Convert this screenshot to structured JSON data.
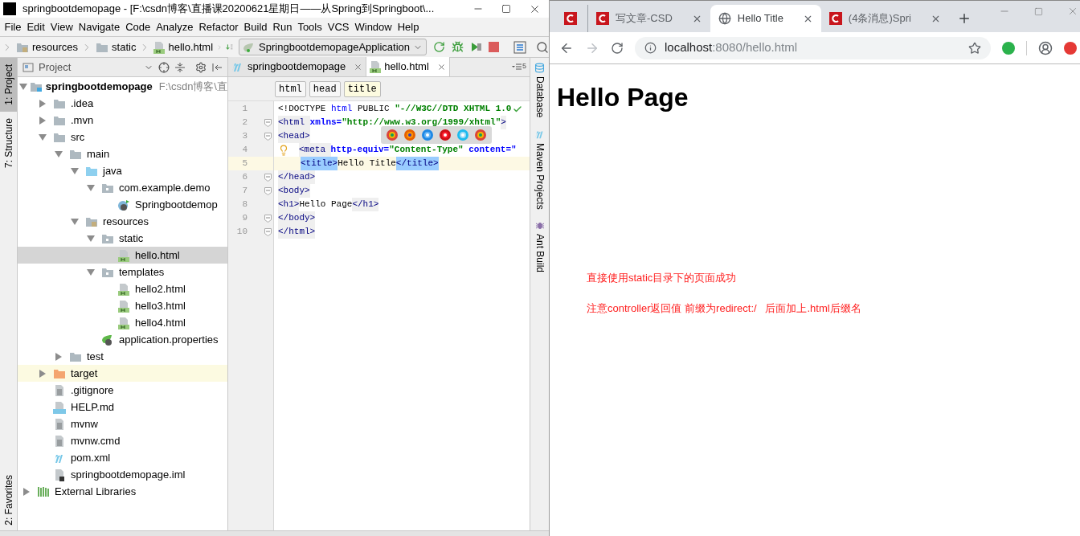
{
  "ide": {
    "title": "springbootdemopage - [F:\\csdn博客\\直播课20200621星期日——从Spring到Springboot\\...",
    "menu": [
      {
        "label": "File"
      },
      {
        "label": "Edit"
      },
      {
        "label": "View"
      },
      {
        "label": "Navigate"
      },
      {
        "label": "Code"
      },
      {
        "label": "Analyze"
      },
      {
        "label": "Refactor"
      },
      {
        "label": "Build"
      },
      {
        "label": "Run"
      },
      {
        "label": "Tools"
      },
      {
        "label": "VCS"
      },
      {
        "label": "Window"
      },
      {
        "label": "Help"
      }
    ],
    "breadcrumbs": [
      {
        "label": "resources",
        "kind": "resources"
      },
      {
        "label": "static",
        "kind": "folder"
      },
      {
        "label": "hello.html",
        "kind": "html"
      }
    ],
    "run_config": "SpringbootdemopageApplication",
    "left_stripe": [
      {
        "label": "1: Project",
        "selected": true
      },
      {
        "label": "7: Structure",
        "selected": false
      }
    ],
    "favorites_label": "2: Favorites",
    "right_stripe": [
      {
        "label": "Database",
        "kind": "database"
      },
      {
        "label": "Maven Projects",
        "kind": "maven"
      },
      {
        "label": "Ant Build",
        "kind": "ant"
      }
    ],
    "project_panel": {
      "title": "Project",
      "tree": [
        {
          "name": "springbootdemopage",
          "path": "F:\\csdn博客\\直",
          "kind": "project",
          "expanded": true,
          "selected": false,
          "highlighted": false,
          "children": [
            {
              "name": ".idea",
              "kind": "folder",
              "expanded": false,
              "selected": false,
              "highlighted": false
            },
            {
              "name": ".mvn",
              "kind": "folder",
              "expanded": false,
              "selected": false,
              "highlighted": false
            },
            {
              "name": "src",
              "kind": "folder",
              "expanded": true,
              "selected": false,
              "highlighted": false,
              "children": [
                {
                  "name": "main",
                  "kind": "folder",
                  "expanded": true,
                  "selected": false,
                  "highlighted": false,
                  "children": [
                    {
                      "name": "java",
                      "kind": "source",
                      "expanded": true,
                      "selected": false,
                      "highlighted": false,
                      "children": [
                        {
                          "name": "com.example.demo",
                          "kind": "package",
                          "expanded": true,
                          "selected": false,
                          "highlighted": false,
                          "children": [
                            {
                              "name": "Springbootdemop",
                              "kind": "class",
                              "selected": false,
                              "highlighted": false
                            }
                          ]
                        }
                      ]
                    },
                    {
                      "name": "resources",
                      "kind": "resources",
                      "expanded": true,
                      "selected": false,
                      "highlighted": false,
                      "children": [
                        {
                          "name": "static",
                          "kind": "package",
                          "expanded": true,
                          "selected": false,
                          "highlighted": false,
                          "children": [
                            {
                              "name": "hello.html",
                              "kind": "html",
                              "selected": true,
                              "highlighted": false
                            }
                          ]
                        },
                        {
                          "name": "templates",
                          "kind": "package",
                          "expanded": true,
                          "selected": false,
                          "highlighted": false,
                          "children": [
                            {
                              "name": "hello2.html",
                              "kind": "html",
                              "selected": false,
                              "highlighted": false
                            },
                            {
                              "name": "hello3.html",
                              "kind": "html",
                              "selected": false,
                              "highlighted": false
                            },
                            {
                              "name": "hello4.html",
                              "kind": "html",
                              "selected": false,
                              "highlighted": false
                            }
                          ]
                        },
                        {
                          "name": "application.properties",
                          "kind": "properties",
                          "selected": false,
                          "highlighted": false
                        }
                      ]
                    }
                  ]
                },
                {
                  "name": "test",
                  "kind": "folder",
                  "expanded": false,
                  "selected": false,
                  "highlighted": false
                }
              ]
            },
            {
              "name": "target",
              "kind": "excluded",
              "expanded": false,
              "selected": false,
              "highlighted": true
            },
            {
              "name": ".gitignore",
              "kind": "text",
              "selected": false,
              "highlighted": false
            },
            {
              "name": "HELP.md",
              "kind": "markdown",
              "selected": false,
              "highlighted": false
            },
            {
              "name": "mvnw",
              "kind": "text",
              "selected": false,
              "highlighted": false
            },
            {
              "name": "mvnw.cmd",
              "kind": "text",
              "selected": false,
              "highlighted": false
            },
            {
              "name": "pom.xml",
              "kind": "maven",
              "selected": false,
              "highlighted": false
            },
            {
              "name": "springbootdemopage.iml",
              "kind": "iml",
              "selected": false,
              "highlighted": false
            }
          ]
        },
        {
          "name": "External Libraries",
          "kind": "libraries",
          "expanded": false,
          "selected": false,
          "highlighted": false
        }
      ]
    },
    "editor": {
      "tabs": [
        {
          "label": "springbootdemopage",
          "kind": "maven",
          "selected": false
        },
        {
          "label": "hello.html",
          "kind": "html",
          "selected": true
        }
      ],
      "tab_count": "5",
      "tag_path": [
        {
          "label": "html",
          "selected": false
        },
        {
          "label": "head",
          "selected": false
        },
        {
          "label": "title",
          "selected": true
        }
      ],
      "lines": [
        {
          "number": "1",
          "current": false,
          "fold": false,
          "tokens": [
            {
              "text": "<!DOCTYPE ",
              "kind": "plain"
            },
            {
              "text": "html",
              "kind": "keyword"
            },
            {
              "text": " PUBLIC ",
              "kind": "plain"
            },
            {
              "text": "\"-//W3C//DTD XHTML 1.0",
              "kind": "string"
            }
          ]
        },
        {
          "number": "2",
          "current": false,
          "fold": true,
          "tokens": [
            {
              "text": "<html ",
              "kind": "tag"
            },
            {
              "text": "xmlns=",
              "kind": "attr"
            },
            {
              "text": "\"http://www.w3.org/1999/xhtml\"",
              "kind": "string"
            },
            {
              "text": ">",
              "kind": "tag"
            }
          ]
        },
        {
          "number": "3",
          "current": false,
          "fold": true,
          "tokens": [
            {
              "text": "<head>",
              "kind": "tag"
            }
          ]
        },
        {
          "number": "4",
          "current": false,
          "fold": false,
          "tokens": [
            {
              "text": "<meta ",
              "kind": "tag"
            },
            {
              "text": "http-equiv=",
              "kind": "attr"
            },
            {
              "text": "\"Content-Type\" ",
              "kind": "string"
            },
            {
              "text": "content=\"",
              "kind": "attr"
            }
          ]
        },
        {
          "number": "5",
          "current": true,
          "fold": false,
          "tokens": [
            {
              "text": "<title>",
              "kind": "matched"
            },
            {
              "text": "Hello Title",
              "kind": "text"
            },
            {
              "text": "</title>",
              "kind": "matched"
            }
          ]
        },
        {
          "number": "6",
          "current": false,
          "fold": true,
          "tokens": [
            {
              "text": "</head>",
              "kind": "tag"
            }
          ]
        },
        {
          "number": "7",
          "current": false,
          "fold": true,
          "tokens": [
            {
              "text": "<body>",
              "kind": "tag"
            }
          ]
        },
        {
          "number": "8",
          "current": false,
          "fold": false,
          "tokens": [
            {
              "text": "<h1>",
              "kind": "tag"
            },
            {
              "text": "Hello Page",
              "kind": "text"
            },
            {
              "text": "</h1>",
              "kind": "tag"
            }
          ]
        },
        {
          "number": "9",
          "current": false,
          "fold": true,
          "tokens": [
            {
              "text": "</body>",
              "kind": "tag"
            }
          ]
        },
        {
          "number": "10",
          "current": false,
          "fold": true,
          "tokens": [
            {
              "text": "</html>",
              "kind": "tag"
            }
          ]
        }
      ]
    }
  },
  "browser": {
    "tabs": [
      {
        "kind": "pinned",
        "selected": false
      },
      {
        "kind": "csdn",
        "title": "写文章-CSD",
        "selected": false
      },
      {
        "kind": "web",
        "title": "Hello Title",
        "selected": true
      },
      {
        "kind": "csdn",
        "title": "(4条消息)Spri",
        "selected": false
      }
    ],
    "forward_enabled": false,
    "address": {
      "host": "localhost",
      "rest": ":8080/hello.html"
    },
    "page": {
      "heading": "Hello Page",
      "notes": [
        "直接使用static目录下的页面成功",
        "注意controller返回值 前缀为redirect:/   后面加上.html后缀名"
      ]
    }
  }
}
